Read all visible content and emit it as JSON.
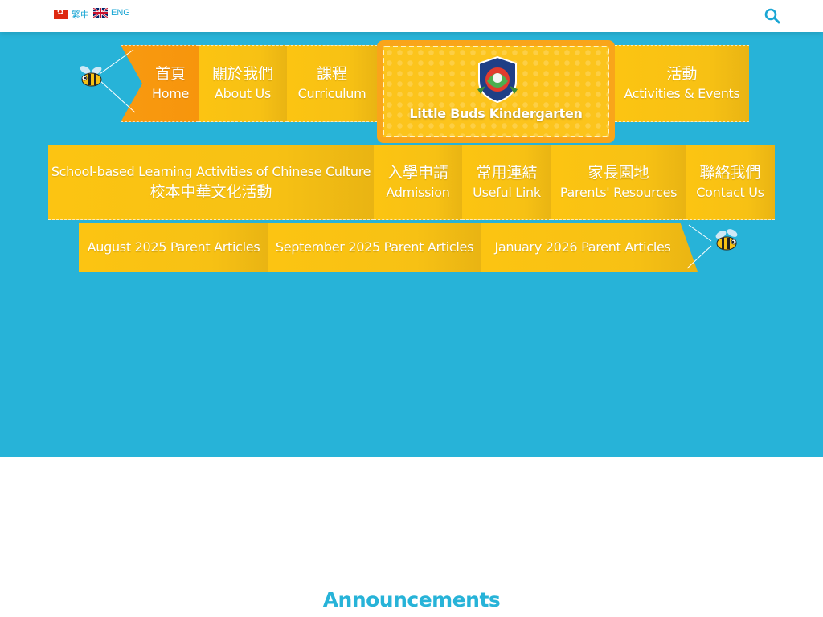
{
  "topbar": {
    "lang_zh": "繁中",
    "lang_en": "ENG",
    "search_icon": "search-icon"
  },
  "logo": {
    "text": "Little Buds Kindergarten",
    "badge_icon": "school-crest"
  },
  "nav": {
    "row1": [
      {
        "zh": "首頁",
        "en": "Home"
      },
      {
        "zh": "關於我們",
        "en": "About Us"
      },
      {
        "zh": "課程",
        "en": "Curriculum"
      },
      {
        "zh": "活動",
        "en": "Activities & Events"
      }
    ],
    "row2": [
      {
        "zh": "校本中華文化活動",
        "en": "School-based Learning Activities of Chinese Culture"
      },
      {
        "zh": "入學申請",
        "en": "Admission"
      },
      {
        "zh": "常用連結",
        "en": "Useful Link"
      },
      {
        "zh": "家長園地",
        "en": "Parents' Resources"
      },
      {
        "zh": "聯絡我們",
        "en": "Contact Us"
      }
    ],
    "row3": [
      {
        "en": "August 2025 Parent Articles"
      },
      {
        "en": "September 2025 Parent Articles"
      },
      {
        "en": "January 2026 Parent Articles"
      }
    ]
  },
  "colors": {
    "hero_bg": "#27b3d8",
    "nav_yellow": "#fcc412",
    "nav_active": "#f89a10",
    "link_blue": "#1aa6d4"
  },
  "sections": {
    "announcements_title": "Announcements"
  }
}
